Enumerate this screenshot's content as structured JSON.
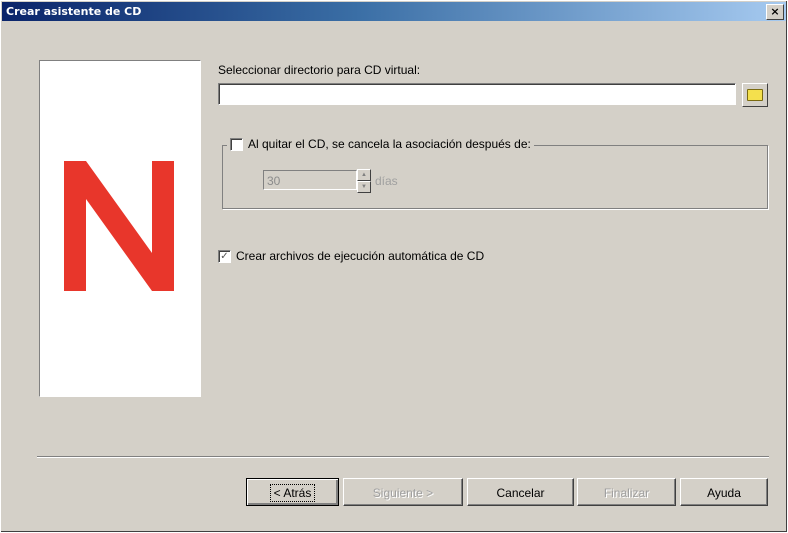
{
  "window": {
    "title": "Crear asistente de CD",
    "close_glyph": "×"
  },
  "logo": {
    "icon": "novell-n-logo",
    "color": "#e8362b"
  },
  "directory": {
    "label": "Seleccionar directorio para CD virtual:",
    "value": "",
    "browse_icon": "folder-icon"
  },
  "dissociate": {
    "checked": false,
    "label": "Al quitar el CD, se cancela la asociación después de:",
    "value": "30",
    "unit": "días"
  },
  "autorun": {
    "checked": true,
    "label": "Crear archivos de ejecución automática de CD"
  },
  "buttons": {
    "back": "< Atrás",
    "next": "Siguiente >",
    "cancel": "Cancelar",
    "finish": "Finalizar",
    "help": "Ayuda"
  }
}
